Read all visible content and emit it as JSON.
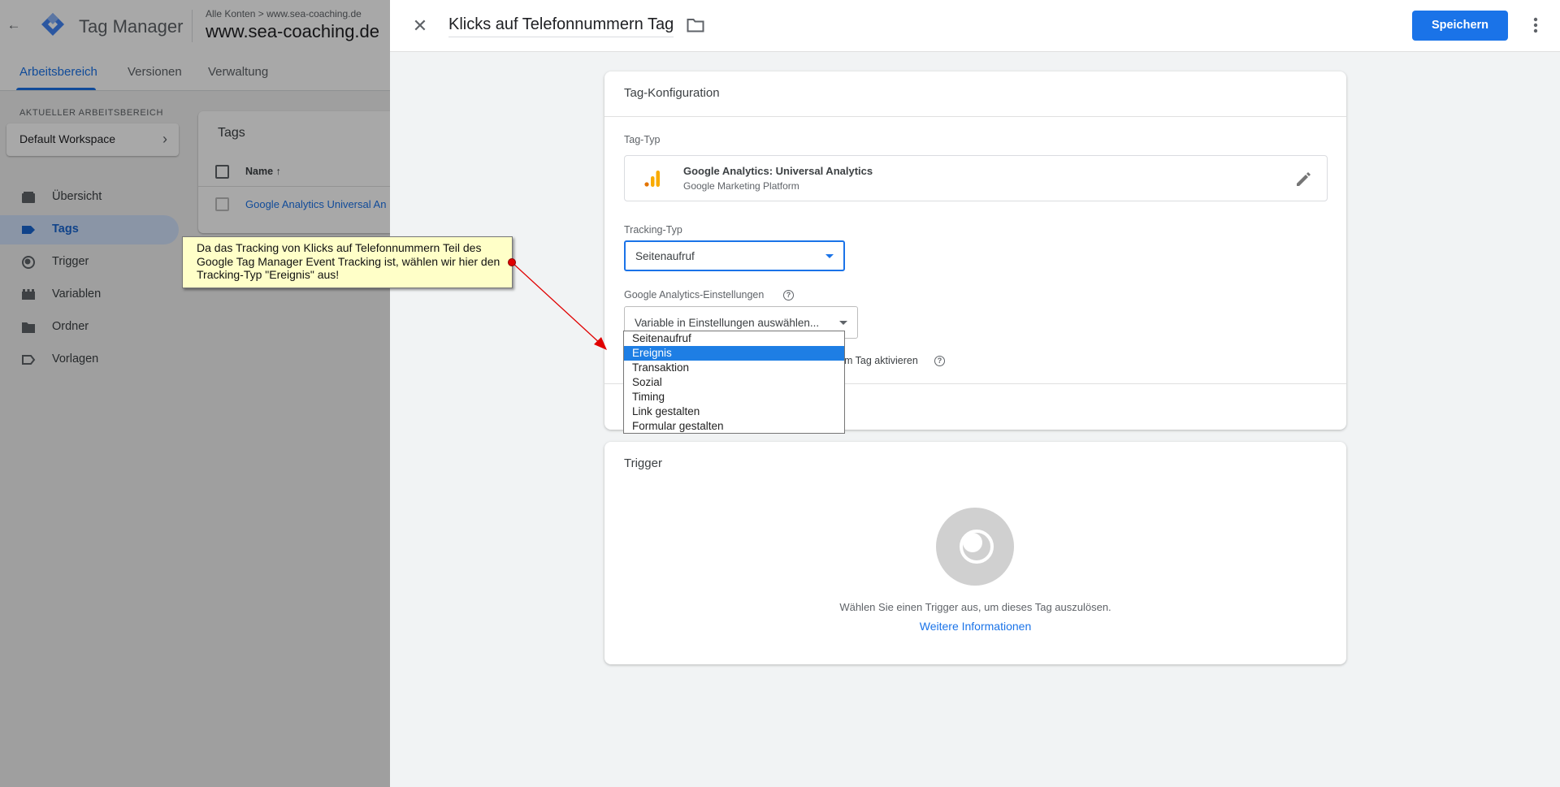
{
  "app": {
    "name": "Tag Manager",
    "breadcrumb_root": "Alle Konten",
    "breadcrumb_sep": ">",
    "breadcrumb_account": "www.sea-coaching.de",
    "container_name": "www.sea-coaching.de"
  },
  "nav_tabs": [
    {
      "label": "Arbeitsbereich",
      "active": true
    },
    {
      "label": "Versionen"
    },
    {
      "label": "Verwaltung"
    }
  ],
  "workspace": {
    "section_label": "AKTUELLER ARBEITSBEREICH",
    "name": "Default Workspace"
  },
  "sidebar": [
    {
      "label": "Übersicht",
      "icon": "overview-icon"
    },
    {
      "label": "Tags",
      "icon": "tag-icon",
      "active": true
    },
    {
      "label": "Trigger",
      "icon": "trigger-icon"
    },
    {
      "label": "Variablen",
      "icon": "variables-icon"
    },
    {
      "label": "Ordner",
      "icon": "folder-icon"
    },
    {
      "label": "Vorlagen",
      "icon": "templates-icon"
    }
  ],
  "tags_list": {
    "title": "Tags",
    "column_name": "Name",
    "rows": [
      "Google Analytics Universal An"
    ]
  },
  "editor": {
    "tag_name": "Klicks auf Telefonnummern Tag",
    "save_label": "Speichern",
    "config": {
      "header": "Tag-Konfiguration",
      "tag_type_label": "Tag-Typ",
      "tag_type_name": "Google Analytics: Universal Analytics",
      "tag_type_sub": "Google Marketing Platform",
      "tracking_type_label": "Tracking-Typ",
      "tracking_type_value": "Seitenaufruf",
      "ga_settings_label": "Google Analytics-Einstellungen",
      "ga_settings_value": "Variable in Einstellungen auswählen...",
      "override_checkbox_tail": "m Tag aktivieren"
    },
    "tracking_type_options": [
      "Seitenaufruf",
      "Ereignis",
      "Transaktion",
      "Sozial",
      "Timing",
      "Link gestalten",
      "Formular gestalten"
    ],
    "tracking_type_highlighted": "Ereignis",
    "trigger": {
      "header": "Trigger",
      "hint": "Wählen Sie einen Trigger aus, um dieses Tag auszulösen.",
      "link": "Weitere Informationen"
    }
  },
  "annotation": {
    "text": "Da das Tracking von Klicks auf Telefonnummern Teil des Google Tag Manager Event Tracking ist, wählen wir hier den Tracking-Typ \"Ereignis\" aus!"
  },
  "colors": {
    "accent": "#1a73e8",
    "annotation_bg": "#ffffc8",
    "arrow": "#e00000",
    "gtm_logo": "#4285f4",
    "ga_logo_orange": "#f9ab00",
    "ga_logo_dark": "#e37400"
  }
}
